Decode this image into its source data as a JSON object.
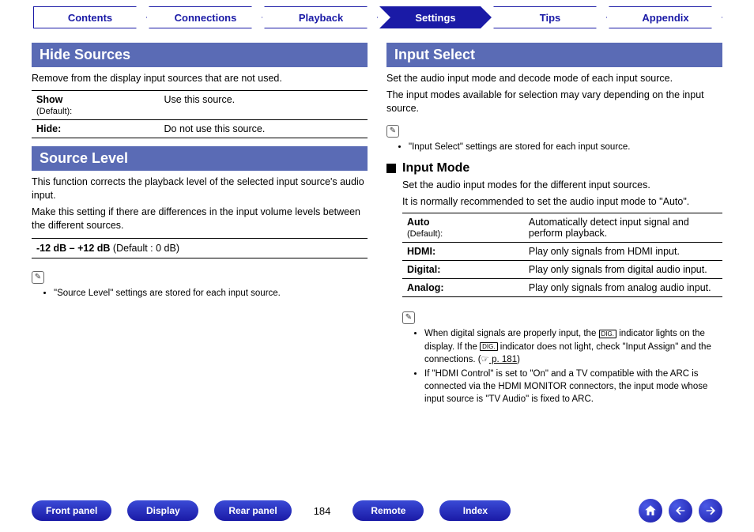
{
  "nav": {
    "tabs": [
      "Contents",
      "Connections",
      "Playback",
      "Settings",
      "Tips",
      "Appendix"
    ],
    "active_index": 3
  },
  "left": {
    "hide_sources": {
      "title": "Hide Sources",
      "desc": "Remove from the display input sources that are not used.",
      "rows": [
        {
          "key": "Show",
          "sub": "(Default):",
          "val": "Use this source."
        },
        {
          "key": "Hide:",
          "sub": "",
          "val": "Do not use this source."
        }
      ]
    },
    "source_level": {
      "title": "Source Level",
      "desc1": "This function corrects the playback level of the selected input source's audio input.",
      "desc2": "Make this setting if there are differences in the input volume levels between the different sources.",
      "range_bold": "-12 dB – +12 dB",
      "range_rest": " (Default : 0 dB)",
      "notes": [
        "\"Source Level\" settings are stored for each input source."
      ]
    }
  },
  "right": {
    "input_select": {
      "title": "Input Select",
      "desc1": "Set the audio input mode and decode mode of each input source.",
      "desc2": "The input modes available for selection may vary depending on the input source.",
      "notes_top": [
        "\"Input Select\" settings are stored for each input source."
      ]
    },
    "input_mode": {
      "title": "Input Mode",
      "desc1": "Set the audio input modes for the different input sources.",
      "desc2": "It is normally recommended to set the audio input mode to \"Auto\".",
      "rows": [
        {
          "key": "Auto",
          "sub": "(Default):",
          "val": "Automatically detect input signal and perform playback."
        },
        {
          "key": "HDMI:",
          "sub": "",
          "val": "Play only signals from HDMI input."
        },
        {
          "key": "Digital:",
          "sub": "",
          "val": "Play only signals from digital audio input."
        },
        {
          "key": "Analog:",
          "sub": "",
          "val": "Play only signals from analog audio input."
        }
      ],
      "notes_bottom": [
        {
          "pre": "When digital signals are properly input, the ",
          "mid": " indicator lights on the display. If the ",
          "post": " indicator does not light, check \"Input Assign\" and the connections. (",
          "link": " p. 181",
          "tail": ")"
        },
        {
          "text": "If \"HDMI Control\" is set to \"On\" and a TV compatible with the ARC is connected via the HDMI MONITOR connectors, the input mode whose input source is \"TV Audio\" is fixed to ARC."
        }
      ],
      "dig_label": "DIG."
    }
  },
  "footer": {
    "pills": [
      "Front panel",
      "Display",
      "Rear panel"
    ],
    "page": "184",
    "pills2": [
      "Remote",
      "Index"
    ]
  },
  "icons": {
    "pencil": "✎",
    "pointer": "☞",
    "home": "⌂",
    "prev": "←",
    "next": "→"
  }
}
